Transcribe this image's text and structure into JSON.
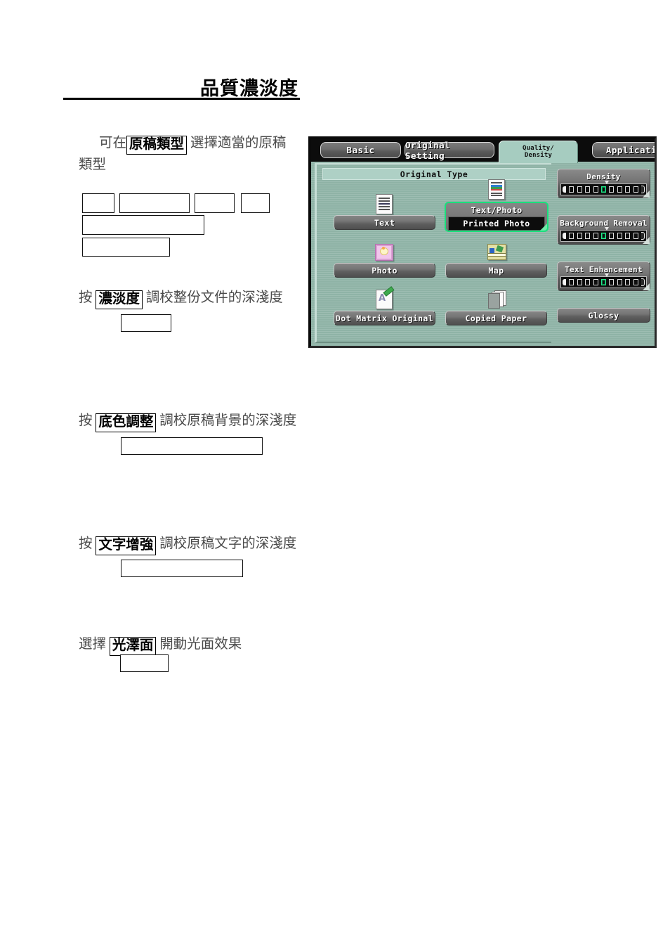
{
  "document": {
    "title": "品質濃淡度",
    "paragraphs": [
      {
        "id": "p1a",
        "pre": "可在",
        "boxed": "原稿類型",
        "post": "選擇適當的原稿"
      },
      {
        "id": "p1b",
        "line": "類型"
      },
      {
        "id": "p2",
        "pre": "按",
        "boxed": "濃淡度",
        "post": "調校整份文件的深淺度"
      },
      {
        "id": "p3",
        "pre": "按",
        "boxed": "底色調整",
        "post": "調校原稿背景的深淺度"
      },
      {
        "id": "p4",
        "pre": "按",
        "boxed": "文字增強",
        "post": "調校原稿文字的深淺度"
      },
      {
        "id": "p5",
        "pre": "選擇",
        "boxed": "光澤面",
        "post": "開動光面效果"
      }
    ]
  },
  "panel": {
    "tabs": [
      {
        "label": "Basic",
        "active": false
      },
      {
        "label": "Original Setting",
        "active": false
      },
      {
        "label_line1": "Quality/",
        "label_line2": "Density",
        "active": true
      },
      {
        "label": "Application",
        "active": false
      }
    ],
    "original_type": {
      "header": "Original Type",
      "options": [
        {
          "label": "Text",
          "icon": "text-document-icon",
          "selected": false
        },
        {
          "label": "Text/Photo",
          "sub_label": "Printed Photo",
          "icon": "text-photo-document-icon",
          "selected": true
        },
        {
          "label": "Photo",
          "icon": "photo-icon",
          "selected": false
        },
        {
          "label": "Map",
          "icon": "map-icon",
          "selected": false
        },
        {
          "label": "Dot Matrix Original",
          "icon": "dot-matrix-icon",
          "selected": false
        },
        {
          "label": "Copied Paper",
          "icon": "paper-stack-icon",
          "selected": false
        }
      ]
    },
    "controls": [
      {
        "label": "Density",
        "steps": 9,
        "selected_step": 5
      },
      {
        "label": "Background Removal",
        "steps": 9,
        "selected_step": 5
      },
      {
        "label": "Text Enhancement",
        "steps": 9,
        "selected_step": 5
      }
    ],
    "glossy_label": "Glossy",
    "colors": {
      "panel_background": "#8fb3a6",
      "active_tab": "#a6ccc0",
      "selection_highlight": "#18e07c",
      "button_face": "#6b6b6b",
      "header_bar": "#aed0c5"
    }
  }
}
